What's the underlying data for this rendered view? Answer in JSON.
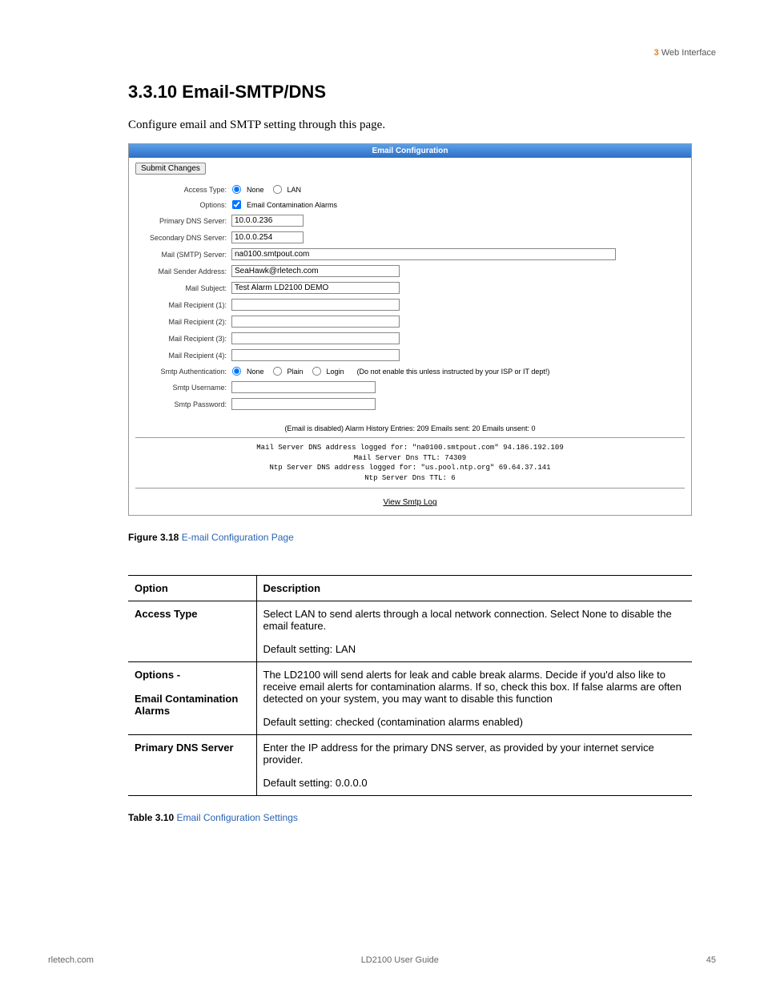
{
  "header": {
    "chapter": "3",
    "title": "Web Interface"
  },
  "section": {
    "number": "3.3.10",
    "title": "Email-SMTP/DNS"
  },
  "intro": "Configure email and SMTP setting through this page.",
  "panel": {
    "title": "Email Configuration",
    "submit": "Submit Changes",
    "rows": {
      "access_type": {
        "label": "Access Type:",
        "opt_none": "None",
        "opt_lan": "LAN"
      },
      "options": {
        "label": "Options:",
        "opt_alarms": "Email Contamination Alarms"
      },
      "primary_dns": {
        "label": "Primary DNS Server:",
        "value": "10.0.0.236"
      },
      "secondary_dns": {
        "label": "Secondary DNS Server:",
        "value": "10.0.0.254"
      },
      "mail_server": {
        "label": "Mail (SMTP) Server:",
        "value": "na0100.smtpout.com"
      },
      "sender": {
        "label": "Mail Sender Address:",
        "value": "SeaHawk@rletech.com"
      },
      "subject": {
        "label": "Mail Subject:",
        "value": "Test Alarm LD2100 DEMO"
      },
      "r1": {
        "label": "Mail Recipient (1):",
        "value": ""
      },
      "r2": {
        "label": "Mail Recipient (2):",
        "value": ""
      },
      "r3": {
        "label": "Mail Recipient (3):",
        "value": ""
      },
      "r4": {
        "label": "Mail Recipient (4):",
        "value": ""
      },
      "smtp_auth": {
        "label": "Smtp Authentication:",
        "opt_none": "None",
        "opt_plain": "Plain",
        "opt_login": "Login",
        "hint": "(Do not enable this unless instructed by your ISP or IT dept!)"
      },
      "smtp_user": {
        "label": "Smtp Username:",
        "value": ""
      },
      "smtp_pass": {
        "label": "Smtp Password:",
        "value": ""
      }
    },
    "status": "(Email is disabled) Alarm History Entries: 209 Emails sent: 20 Emails unsent: 0",
    "mono": {
      "line1": "Mail Server DNS address logged for: \"na0100.smtpout.com\" 94.186.192.109",
      "line2": "Mail Server Dns TTL: 74309",
      "line3": "Ntp Server DNS address logged for: \"us.pool.ntp.org\" 69.64.37.141",
      "line4": "Ntp Server Dns TTL: 6"
    },
    "view_link": "View Smtp Log"
  },
  "figure": {
    "label": "Figure 3.18",
    "title": "E-mail Configuration Page"
  },
  "table": {
    "header_option": "Option",
    "header_desc": "Description",
    "rows": [
      {
        "option": "Access Type",
        "desc": "Select LAN to send alerts through a local network connection. Select None to disable the email feature.",
        "default": "Default setting: LAN"
      },
      {
        "option": "Options -\n\nEmail Contamination Alarms",
        "desc": "The LD2100 will send alerts for leak and cable break alarms. Decide if you'd also like to receive email alerts for contamination alarms. If so, check this box. If false alarms are often detected on your system, you may want to disable this function",
        "default": "Default setting: checked (contamination alarms enabled)"
      },
      {
        "option": "Primary DNS Server",
        "desc": "Enter the IP address for the primary DNS server, as provided by your internet service provider.",
        "default": "Default setting: 0.0.0.0"
      }
    ]
  },
  "table_caption": {
    "label": "Table 3.10",
    "title": "Email Configuration Settings"
  },
  "footer": {
    "left": "rletech.com",
    "center": "LD2100 User Guide",
    "right": "45"
  }
}
